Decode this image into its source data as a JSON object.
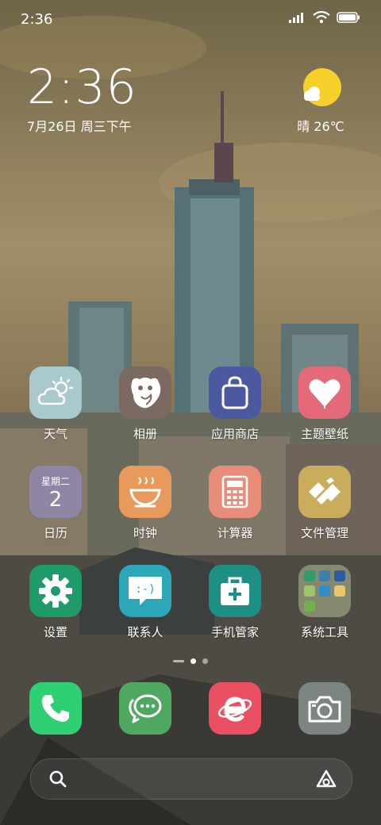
{
  "status_bar": {
    "time": "2:36"
  },
  "clock_widget": {
    "time": "2:36",
    "date": "7月26日 周三下午"
  },
  "weather_widget": {
    "text": "晴 26℃"
  },
  "apps": [
    {
      "label": "天气",
      "icon": "weather-icon",
      "color": "#a9c9cd"
    },
    {
      "label": "相册",
      "icon": "gallery-icon",
      "color": "#7a6a62"
    },
    {
      "label": "应用商店",
      "icon": "app-store-icon",
      "color": "#4b5aa0"
    },
    {
      "label": "主题壁纸",
      "icon": "themes-icon",
      "color": "#e46a7a"
    },
    {
      "label": "日历",
      "icon": "calendar-icon",
      "color": "#8f86a6",
      "calendar_weekday": "星期二",
      "calendar_day": "2"
    },
    {
      "label": "时钟",
      "icon": "clock-icon",
      "color": "#e89a5c"
    },
    {
      "label": "计算器",
      "icon": "calculator-icon",
      "color": "#e88d79"
    },
    {
      "label": "文件管理",
      "icon": "file-manager-icon",
      "color": "#c9ad5c"
    },
    {
      "label": "设置",
      "icon": "settings-icon",
      "color": "#1f9a6a"
    },
    {
      "label": "联系人",
      "icon": "contacts-icon",
      "color": "#2ba7b8"
    },
    {
      "label": "手机管家",
      "icon": "security-icon",
      "color": "#1d8f84"
    },
    {
      "label": "系统工具",
      "icon": "folder-icon",
      "color": "rgba(180,190,150,0.55)"
    }
  ],
  "dock": [
    {
      "name": "phone",
      "icon": "phone-icon",
      "color": "#2fcf73"
    },
    {
      "name": "messages",
      "icon": "messages-icon",
      "color": "#4fa860"
    },
    {
      "name": "browser",
      "icon": "browser-icon",
      "color": "#ea4f62"
    },
    {
      "name": "camera",
      "icon": "camera-icon",
      "color": "#7c8580"
    }
  ],
  "search_bar": {
    "left_icon": "search-icon",
    "right_icon": "assistant-icon"
  }
}
